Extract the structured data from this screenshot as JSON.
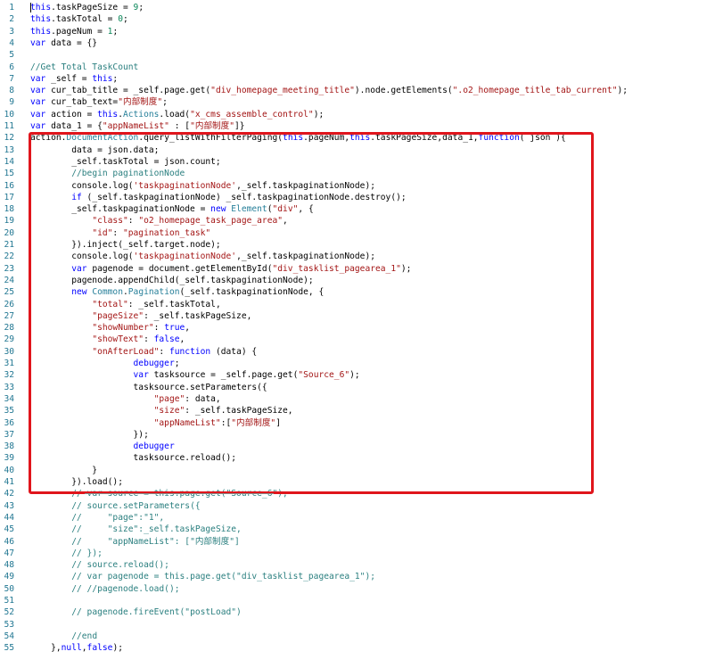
{
  "editor": {
    "language": "javascript",
    "highlight_color": "#e0151c",
    "lines": [
      {
        "n": "1",
        "text": "this.taskPageSize = 9;"
      },
      {
        "n": "2",
        "text": "this.taskTotal = 0;"
      },
      {
        "n": "3",
        "text": "this.pageNum = 1;"
      },
      {
        "n": "4",
        "text": "var data = {}"
      },
      {
        "n": "5",
        "text": ""
      },
      {
        "n": "6",
        "text": "//Get Total TaskCount"
      },
      {
        "n": "7",
        "text": "var _self = this;"
      },
      {
        "n": "8",
        "text": "var cur_tab_title = _self.page.get(\"div_homepage_meeting_title\").node.getElements(\".o2_homepage_title_tab_current\");"
      },
      {
        "n": "9",
        "text": "var cur_tab_text=\"内部制度\";"
      },
      {
        "n": "10",
        "text": "var action = this.Actions.load(\"x_cms_assemble_control\");"
      },
      {
        "n": "11",
        "text": "var data_1 = {\"appNameList\" : [\"内部制度\"]}"
      },
      {
        "n": "12",
        "text": "action.DocumentAction.query_listWithFilterPaging(this.pageNum,this.taskPageSize,data_1,function( json ){"
      },
      {
        "n": "13",
        "text": "        data = json.data;"
      },
      {
        "n": "14",
        "text": "        _self.taskTotal = json.count;"
      },
      {
        "n": "15",
        "text": "        //begin paginationNode"
      },
      {
        "n": "16",
        "text": "        console.log('taskpaginationNode',_self.taskpaginationNode);"
      },
      {
        "n": "17",
        "text": "        if (_self.taskpaginationNode) _self.taskpaginationNode.destroy();"
      },
      {
        "n": "18",
        "text": "        _self.taskpaginationNode = new Element(\"div\", {"
      },
      {
        "n": "19",
        "text": "            \"class\": \"o2_homepage_task_page_area\","
      },
      {
        "n": "20",
        "text": "            \"id\": \"pagination_task\""
      },
      {
        "n": "21",
        "text": "        }).inject(_self.target.node);"
      },
      {
        "n": "22",
        "text": "        console.log('taskpaginationNode',_self.taskpaginationNode);"
      },
      {
        "n": "23",
        "text": "        var pagenode = document.getElementById(\"div_tasklist_pagearea_1\");"
      },
      {
        "n": "24",
        "text": "        pagenode.appendChild(_self.taskpaginationNode);"
      },
      {
        "n": "25",
        "text": "        new Common.Pagination(_self.taskpaginationNode, {"
      },
      {
        "n": "26",
        "text": "            \"total\": _self.taskTotal,"
      },
      {
        "n": "27",
        "text": "            \"pageSize\": _self.taskPageSize,"
      },
      {
        "n": "28",
        "text": "            \"showNumber\": true,"
      },
      {
        "n": "29",
        "text": "            \"showText\": false,"
      },
      {
        "n": "30",
        "text": "            \"onAfterLoad\": function (data) {"
      },
      {
        "n": "31",
        "text": "                    debugger;"
      },
      {
        "n": "32",
        "text": "                    var tasksource = _self.page.get(\"Source_6\");"
      },
      {
        "n": "33",
        "text": "                    tasksource.setParameters({"
      },
      {
        "n": "34",
        "text": "                        \"page\": data,"
      },
      {
        "n": "35",
        "text": "                        \"size\": _self.taskPageSize,"
      },
      {
        "n": "36",
        "text": "                        \"appNameList\":[\"内部制度\"]"
      },
      {
        "n": "37",
        "text": "                    });"
      },
      {
        "n": "38",
        "text": "                    debugger"
      },
      {
        "n": "39",
        "text": "                    tasksource.reload();"
      },
      {
        "n": "40",
        "text": "            }"
      },
      {
        "n": "41",
        "text": "        }).load();"
      },
      {
        "n": "42",
        "text": "        // var source = this.page.get(\"Source_6\");"
      },
      {
        "n": "43",
        "text": "        // source.setParameters({"
      },
      {
        "n": "44",
        "text": "        //     \"page\":\"1\","
      },
      {
        "n": "45",
        "text": "        //     \"size\":_self.taskPageSize,"
      },
      {
        "n": "46",
        "text": "        //     \"appNameList\": [\"内部制度\"]"
      },
      {
        "n": "47",
        "text": "        // });"
      },
      {
        "n": "48",
        "text": "        // source.reload();"
      },
      {
        "n": "49",
        "text": "        // var pagenode = this.page.get(\"div_tasklist_pagearea_1\");"
      },
      {
        "n": "50",
        "text": "        // //pagenode.load();"
      },
      {
        "n": "51",
        "text": ""
      },
      {
        "n": "52",
        "text": "        // pagenode.fireEvent(\"postLoad\")"
      },
      {
        "n": "53",
        "text": ""
      },
      {
        "n": "54",
        "text": "        //end"
      },
      {
        "n": "55",
        "text": "    },null,false);"
      }
    ]
  }
}
